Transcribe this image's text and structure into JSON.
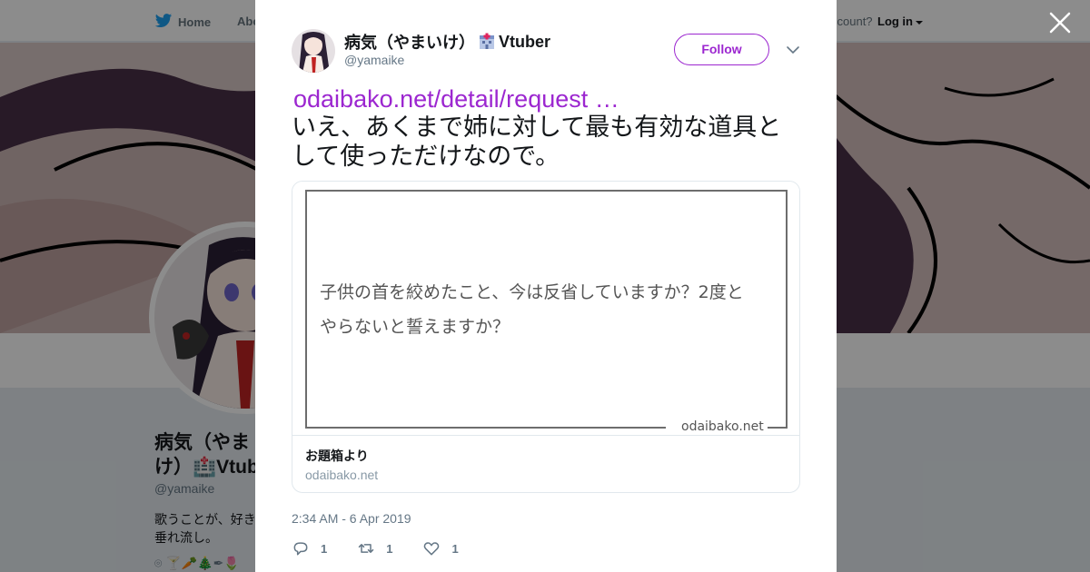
{
  "nav": {
    "home_label": "Home",
    "about_label": "Abo",
    "account_text": "ccount?",
    "login_label": "Log in"
  },
  "profile": {
    "name": "病気（やまいけ）🏥Vtuber",
    "name_line1": "病気（やま",
    "name_line2": "け）🏥Vtub",
    "handle": "@yamaike",
    "bio_line1": "歌うことが、好き",
    "bio_line2": "垂れ流し。",
    "location_text": "🍸🥕🎄✒🌷"
  },
  "tweet": {
    "author_name": "病気（やまいけ）",
    "author_suffix": "Vtuber",
    "author_handle": "@yamaike",
    "follow_label": "Follow",
    "link_text": "odaibako.net/detail/request …",
    "body": "いえ、あくまで姉に対して最も有効な道具として使っただけなので。",
    "timestamp": "2:34 AM - 6 Apr 2019",
    "card": {
      "question_line1": "子供の首を絞めたこと、今は反省していますか？2度と",
      "question_line2": "やらないと誓えますか？",
      "watermark": "odaibako.net",
      "title": "お題箱より",
      "domain": "odaibako.net"
    },
    "actions": {
      "reply_count": "1",
      "retweet_count": "1",
      "like_count": "1"
    }
  },
  "colors": {
    "accent": "#9c27d0",
    "overlay": "rgba(0,0,0,0.45)",
    "twitter_blue": "#1da1f2"
  },
  "icons": {
    "close": "close-icon",
    "reply": "reply-icon",
    "retweet": "retweet-icon",
    "like": "heart-icon",
    "caret": "chevron-down-icon"
  }
}
